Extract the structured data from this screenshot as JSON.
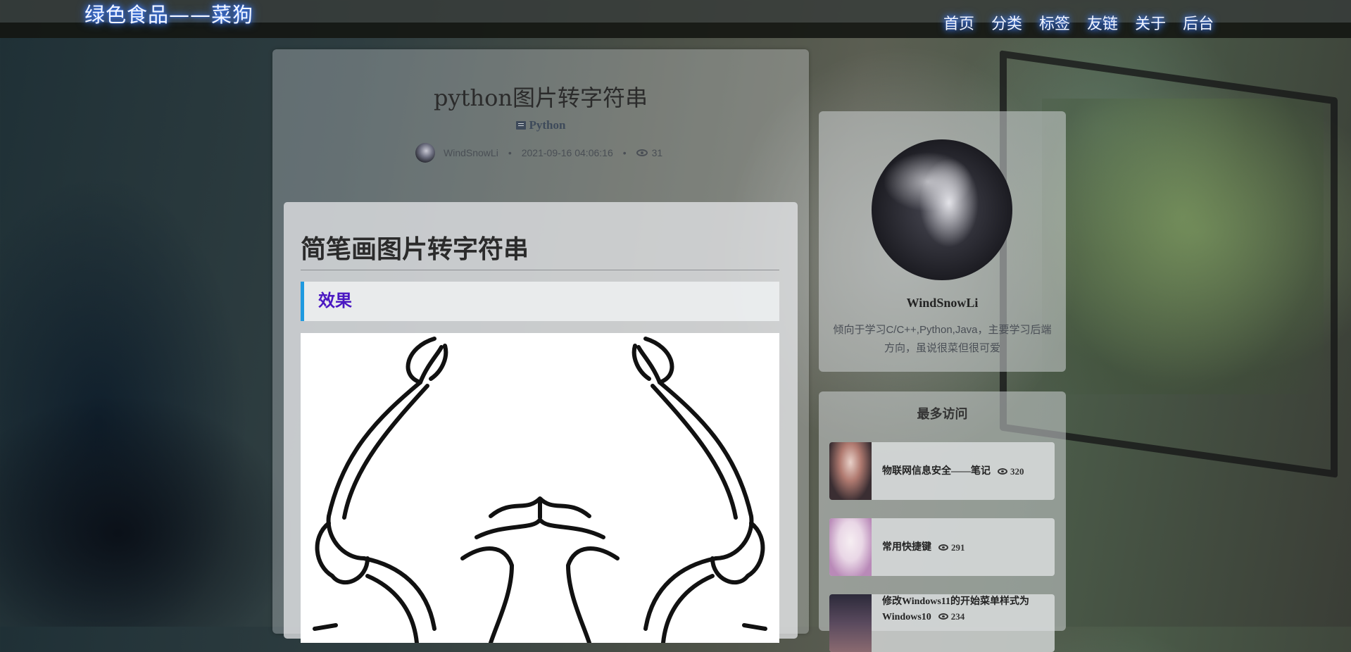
{
  "header": {
    "site_title": "绿色食品——菜狗",
    "nav": [
      "首页",
      "分类",
      "标签",
      "友链",
      "关于",
      "后台"
    ]
  },
  "post": {
    "title": "python图片转字符串",
    "category": "Python",
    "author": "WindSnowLi",
    "date": "2021-09-16 04:06:16",
    "views": "31",
    "separator": "•",
    "content": {
      "heading": "简笔画图片转字符串",
      "section_heading": "效果"
    }
  },
  "profile": {
    "name": "WindSnowLi",
    "bio": "倾向于学习C/C++,Python,Java，主要学习后端方向，虽说很菜但很可爱"
  },
  "popular": {
    "title": "最多访问",
    "items": [
      {
        "title": "物联网信息安全——笔记",
        "views": "320"
      },
      {
        "title": "常用快捷键",
        "views": "291"
      },
      {
        "title": "修改Windows11的开始菜单样式为Windows10",
        "views": "234"
      }
    ]
  },
  "colors": {
    "nav_glow": "#3b7bff",
    "section_accent": "#1f9ae0",
    "section_text": "#4a17c2"
  }
}
